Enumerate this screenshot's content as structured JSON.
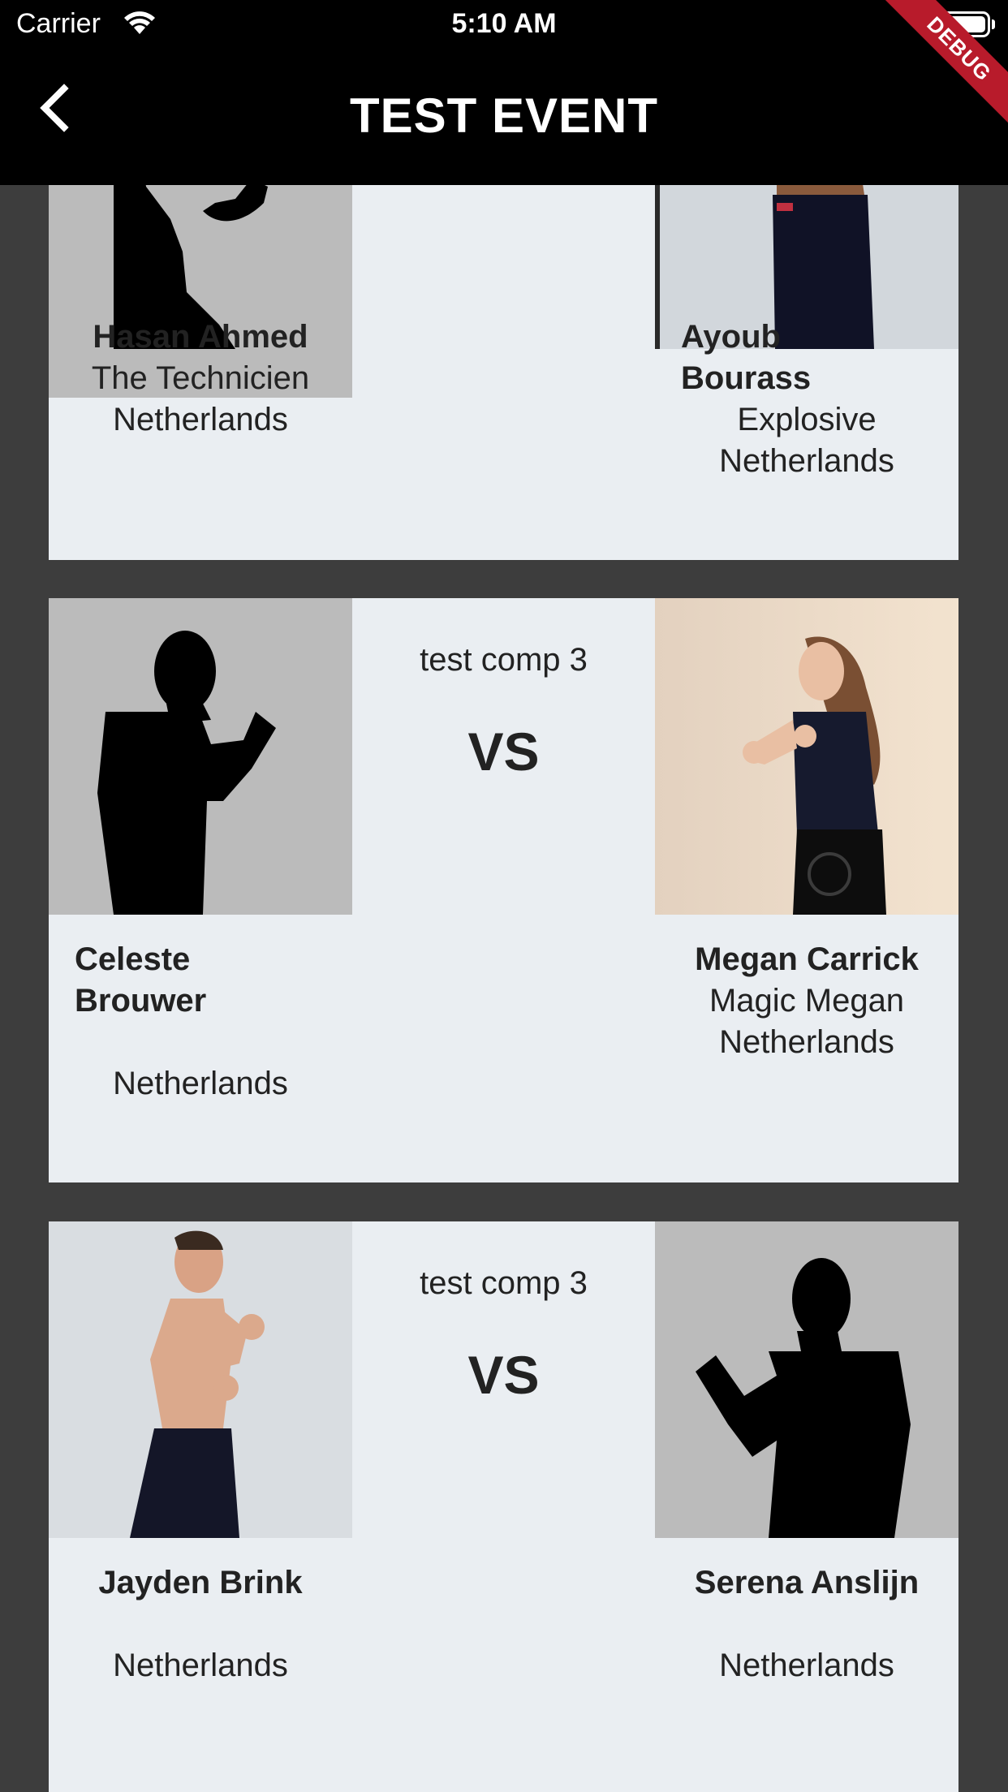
{
  "status_bar": {
    "carrier": "Carrier",
    "time": "5:10 AM"
  },
  "header": {
    "title": "TEST EVENT",
    "debug_banner": "DEBUG"
  },
  "matches": [
    {
      "competition": "",
      "vs": "",
      "left": {
        "name": "Hasan Ahmed",
        "nickname": "The Technicien",
        "country": "Netherlands"
      },
      "right": {
        "name": "Ayoub Bourass",
        "nickname": "Explosive",
        "country": "Netherlands"
      }
    },
    {
      "competition": "test comp 3",
      "vs": "VS",
      "left": {
        "name": "Celeste Brouwer",
        "nickname": "",
        "country": "Netherlands"
      },
      "right": {
        "name": "Megan Carrick",
        "nickname": "Magic Megan",
        "country": "Netherlands"
      }
    },
    {
      "competition": "test comp 3",
      "vs": "VS",
      "left": {
        "name": "Jayden Brink",
        "nickname": "",
        "country": "Netherlands"
      },
      "right": {
        "name": "Serena Anslijn",
        "nickname": "",
        "country": "Netherlands"
      }
    }
  ],
  "colors": {
    "header_bg": "#000000",
    "page_bg": "#3d3d3d",
    "card_bg": "#eaeef2",
    "debug": "#b81b2b"
  }
}
